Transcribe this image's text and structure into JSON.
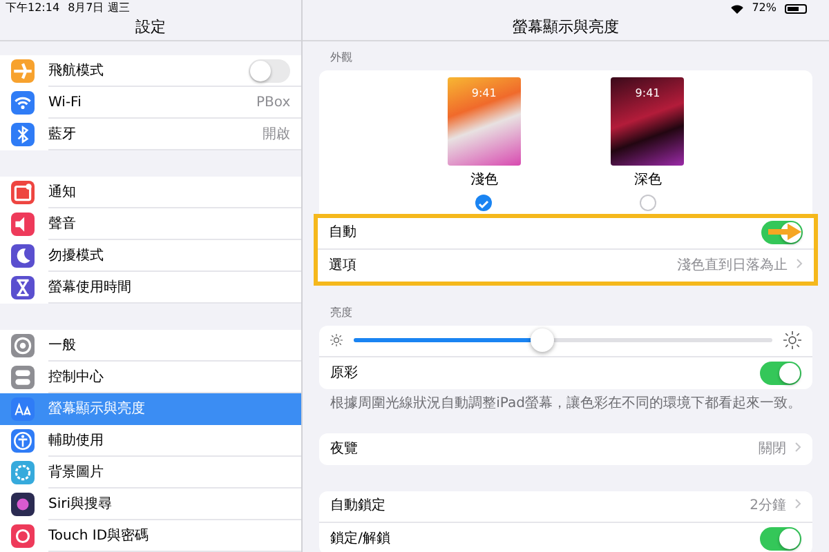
{
  "status_bar": {
    "time": "下午12:14",
    "date": "8月7日 週三",
    "battery": "72%"
  },
  "sidebar": {
    "title": "設定",
    "groups": [
      {
        "items": [
          {
            "label": "飛航模式",
            "kind": "toggle",
            "on": false,
            "selected": false,
            "color": "#f7a22e"
          },
          {
            "label": "Wi-Fi",
            "kind": "value",
            "value": "PBox",
            "selected": false,
            "color": "#2f7cf6"
          },
          {
            "label": "藍牙",
            "kind": "value",
            "value": "開啟",
            "selected": false,
            "color": "#2f7cf6"
          }
        ]
      },
      {
        "items": [
          {
            "label": "通知",
            "kind": "link",
            "selected": false,
            "color": "#ee4540"
          },
          {
            "label": "聲音",
            "kind": "link",
            "selected": false,
            "color": "#ee3a5a"
          },
          {
            "label": "勿擾模式",
            "kind": "link",
            "selected": false,
            "color": "#5a4fcf"
          },
          {
            "label": "螢幕使用時間",
            "kind": "link",
            "selected": false,
            "color": "#5a4fcf"
          }
        ]
      },
      {
        "items": [
          {
            "label": "一般",
            "kind": "link",
            "selected": false,
            "color": "#8e8e93"
          },
          {
            "label": "控制中心",
            "kind": "link",
            "selected": false,
            "color": "#8e8e93"
          },
          {
            "label": "螢幕顯示與亮度",
            "kind": "link",
            "selected": true,
            "color": "#2f7cf6"
          },
          {
            "label": "輔助使用",
            "kind": "link",
            "selected": false,
            "color": "#2f7cf6"
          },
          {
            "label": "背景圖片",
            "kind": "link",
            "selected": false,
            "color": "#36aadc"
          },
          {
            "label": "Siri與搜尋",
            "kind": "link",
            "selected": false,
            "color": "#2b2b52"
          },
          {
            "label": "Touch ID與密碼",
            "kind": "link",
            "selected": false,
            "color": "#ee3a5a"
          }
        ]
      }
    ]
  },
  "detail": {
    "title": "螢幕顯示與亮度",
    "appearance": {
      "header": "外觀",
      "options": [
        {
          "label": "淺色",
          "kind": "light",
          "time": "9:41",
          "selected": true
        },
        {
          "label": "深色",
          "kind": "dark",
          "time": "9:41",
          "selected": false
        }
      ],
      "highlight": true,
      "rows": [
        {
          "kind": "toggle",
          "label": "自動",
          "on": true,
          "arrow": true
        },
        {
          "kind": "link",
          "label": "選項",
          "value": "淺色直到日落為止"
        }
      ]
    },
    "brightness": {
      "header": "亮度",
      "level": 0.45,
      "rows": [
        {
          "kind": "toggle",
          "label": "原彩",
          "on": true
        }
      ],
      "footnote": "根據周圍光線狀況自動調整iPad螢幕，讓色彩在不同的環境下都看起來一致。"
    },
    "groups": [
      {
        "rows": [
          {
            "kind": "link",
            "label": "夜覽",
            "value": "關閉"
          }
        ]
      },
      {
        "rows": [
          {
            "kind": "link",
            "label": "自動鎖定",
            "value": "2分鐘"
          },
          {
            "kind": "toggle",
            "label": "鎖定/解鎖",
            "on": true
          }
        ]
      }
    ]
  }
}
